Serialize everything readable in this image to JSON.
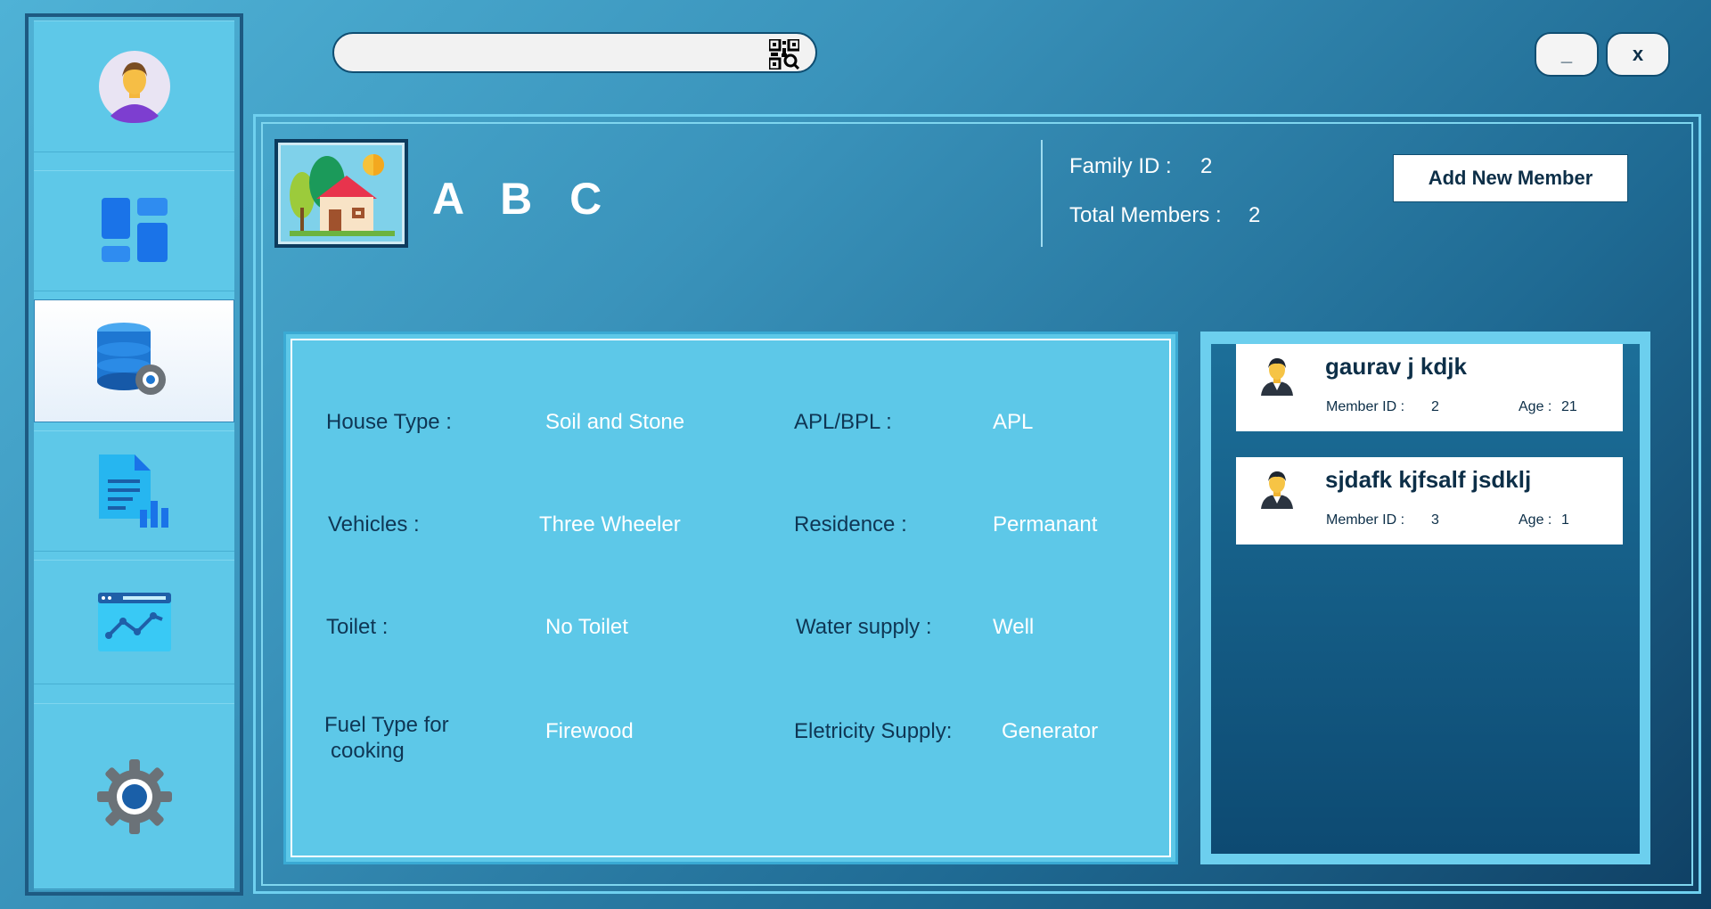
{
  "search": {
    "placeholder": ""
  },
  "window_controls": {
    "minimize_label": "_",
    "close_label": "x"
  },
  "family": {
    "name": "A B C",
    "id_label": "Family ID :",
    "id_value": "2",
    "members_label": "Total Members :",
    "members_value": "2",
    "add_member_label": "Add New Member"
  },
  "details": {
    "house_type_label": "House Type :",
    "house_type_value": "Soil and Stone",
    "apl_label": "APL/BPL :",
    "apl_value": "APL",
    "vehicles_label": "Vehicles :",
    "vehicles_value": "Three Wheeler",
    "residence_label": "Residence :",
    "residence_value": "Permanant",
    "toilet_label": "Toilet :",
    "toilet_value": "No Toilet",
    "water_label": "Water supply :",
    "water_value": "Well",
    "fuel_label_1": "Fuel Type for",
    "fuel_label_2": "cooking",
    "fuel_value": "Firewood",
    "electricity_label": "Eletricity Supply:",
    "electricity_value": "Generator"
  },
  "members": [
    {
      "name": "gaurav j kdjk",
      "id_label": "Member ID :",
      "id": "2",
      "age_label": "Age :",
      "age": "21"
    },
    {
      "name": "sjdafk kjfsalf jsdklj",
      "id_label": "Member ID :",
      "id": "3",
      "age_label": "Age :",
      "age": "1"
    }
  ],
  "icons": {
    "sidebar": [
      "user-avatar-icon",
      "dashboard-icon",
      "database-settings-icon",
      "report-document-icon",
      "analytics-chart-icon",
      "settings-gear-icon"
    ],
    "search": "qr-scan-icon",
    "family": "house-icon",
    "member": "member-avatar-icon"
  }
}
